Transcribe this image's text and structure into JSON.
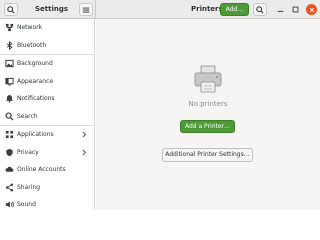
{
  "header": {
    "app_title": "Settings",
    "panel_title": "Printers",
    "add_label": "Add…"
  },
  "sidebar": {
    "items": [
      {
        "label": "Network",
        "icon": "network-icon"
      },
      {
        "label": "Bluetooth",
        "icon": "bluetooth-icon"
      },
      {
        "label": "Background",
        "icon": "background-icon"
      },
      {
        "label": "Appearance",
        "icon": "appearance-icon"
      },
      {
        "label": "Notifications",
        "icon": "bell-icon"
      },
      {
        "label": "Search",
        "icon": "search-icon"
      },
      {
        "label": "Applications",
        "icon": "applications-icon",
        "has_submenu": true
      },
      {
        "label": "Privacy",
        "icon": "privacy-icon",
        "has_submenu": true
      },
      {
        "label": "Online Accounts",
        "icon": "cloud-icon"
      },
      {
        "label": "Sharing",
        "icon": "share-icon"
      },
      {
        "label": "Sound",
        "icon": "speaker-icon"
      }
    ]
  },
  "main": {
    "empty_text": "No printers",
    "add_printer_label": "Add a Printer…",
    "advanced_label": "Additional Printer Settings…"
  },
  "colors": {
    "accent_green": "#4e9a36",
    "close_orange": "#e95420"
  }
}
